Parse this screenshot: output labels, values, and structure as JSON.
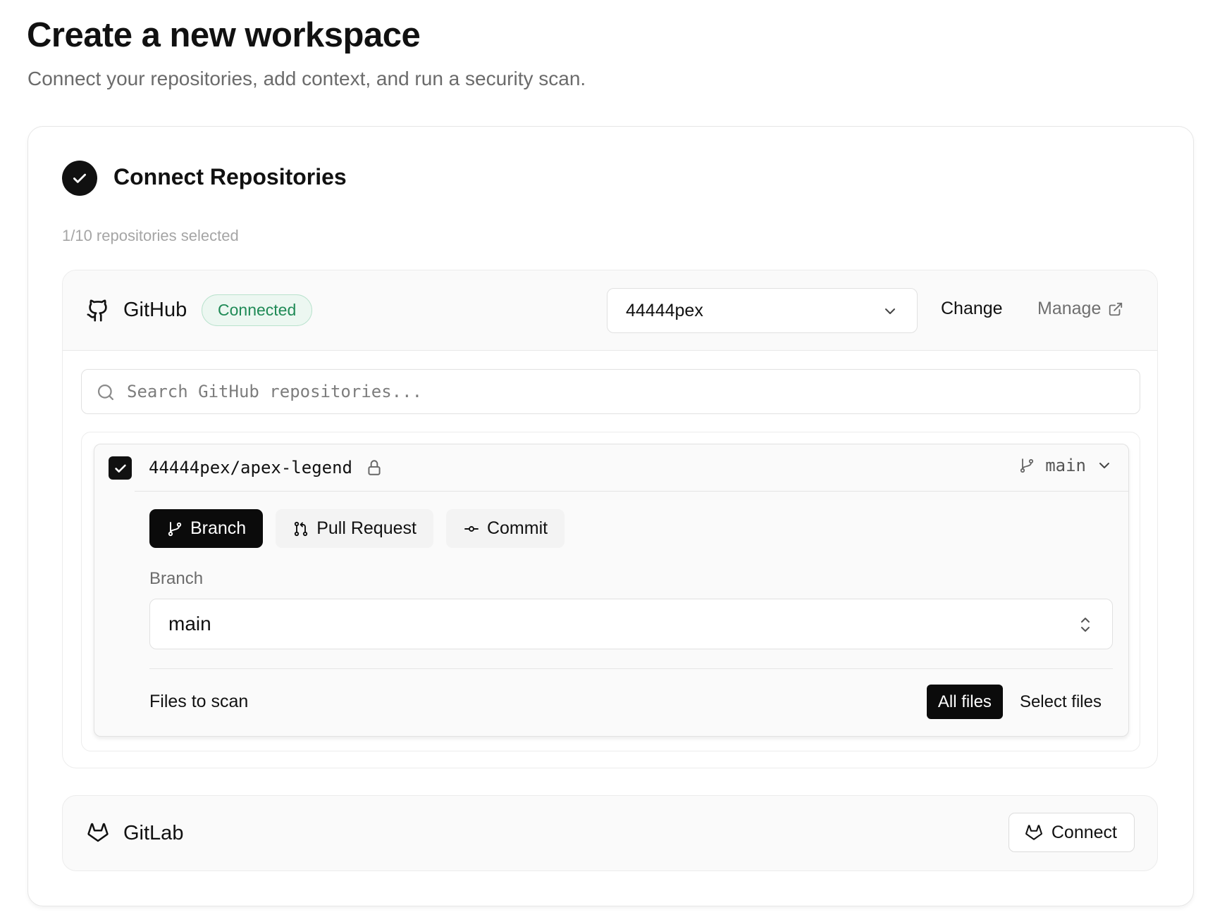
{
  "header": {
    "title": "Create a new workspace",
    "subtitle": "Connect your repositories, add context, and run a security scan."
  },
  "step": {
    "title": "Connect Repositories",
    "selected_count": "1/10 repositories selected",
    "icon": "check-icon"
  },
  "github": {
    "name": "GitHub",
    "icon": "github-icon",
    "status": "Connected",
    "status_color": "#1f8a56",
    "org_value": "44444pex",
    "change_label": "Change",
    "manage_label": "Manage",
    "search_placeholder": "Search GitHub repositories...",
    "repo": {
      "name": "44444pex/apex-legend",
      "checked": true,
      "private": true,
      "branch": "main",
      "tabs": [
        {
          "label": "Branch",
          "active": true
        },
        {
          "label": "Pull Request",
          "active": false
        },
        {
          "label": "Commit",
          "active": false
        }
      ],
      "branch_label": "Branch",
      "branch_value": "main",
      "files_label": "Files to scan",
      "files_options": [
        {
          "label": "All files",
          "active": true
        },
        {
          "label": "Select files",
          "active": false
        }
      ]
    }
  },
  "gitlab": {
    "name": "GitLab",
    "icon": "gitlab-icon",
    "connect_label": "Connect"
  }
}
